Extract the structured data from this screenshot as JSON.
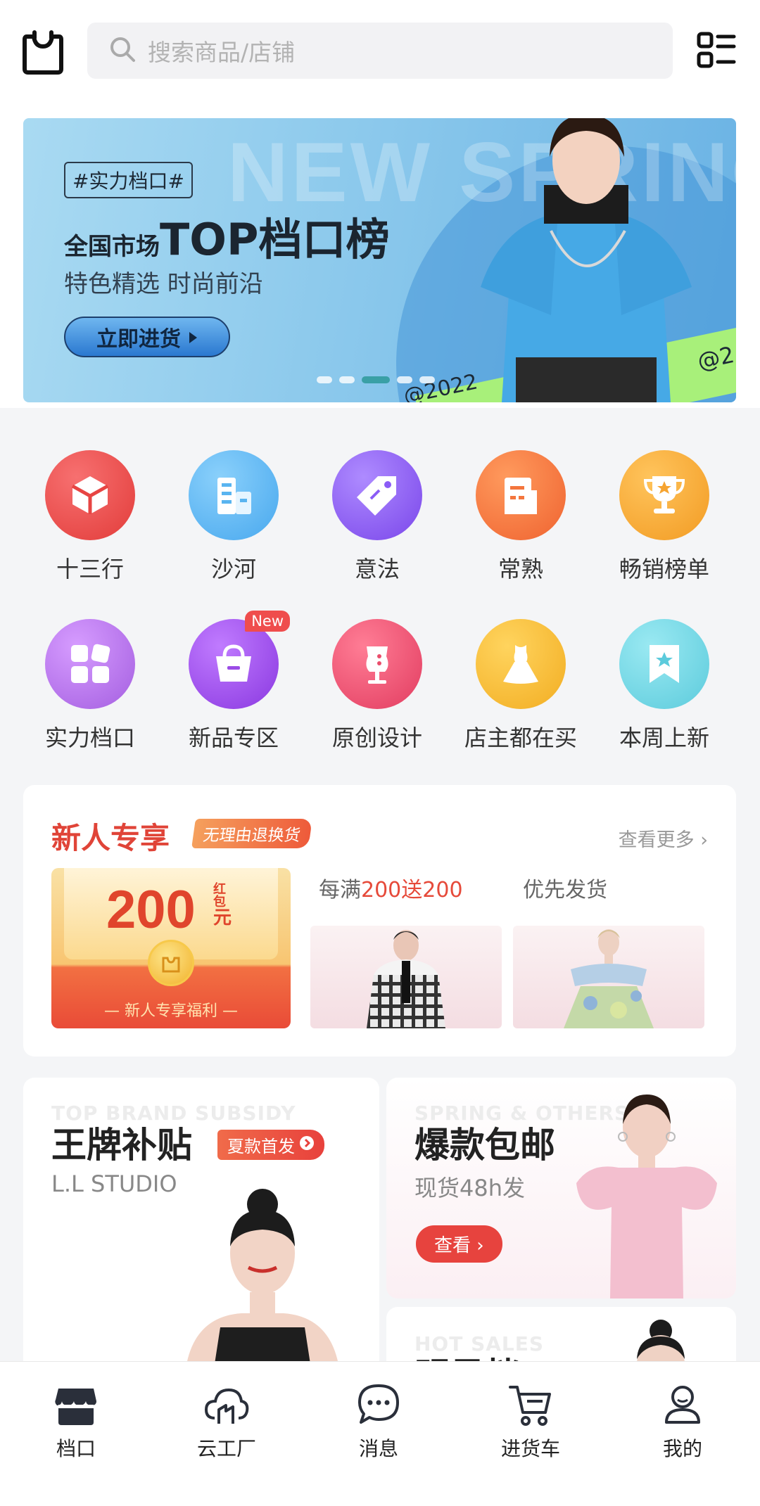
{
  "search": {
    "placeholder": "搜索商品/店铺"
  },
  "banner": {
    "tag": "#实力档口#",
    "title_prefix": "全国市场",
    "title_main": "TOP档口榜",
    "subtitle": "特色精选 时尚前沿",
    "cta": "立即进货",
    "ghost_text": "NEW SPRING",
    "watermark_1": "@2022",
    "watermark_2": "@2",
    "pager": {
      "count": 5,
      "active_index": 2
    }
  },
  "categories": [
    {
      "label": "十三行",
      "icon": "cube-icon",
      "color": "#ea4b48"
    },
    {
      "label": "沙河",
      "icon": "buildings-icon",
      "color": "#59b4f0"
    },
    {
      "label": "意法",
      "icon": "price-tag-icon",
      "color": "#8b5cf6"
    },
    {
      "label": "常熟",
      "icon": "office-icon",
      "color": "#f4763d"
    },
    {
      "label": "畅销榜单",
      "icon": "trophy-icon",
      "color": "#f6a431"
    },
    {
      "label": "实力档口",
      "icon": "grid-icon",
      "color": "#b06ee6"
    },
    {
      "label": "新品专区",
      "icon": "shopping-bag-icon",
      "color": "#9b4ce6",
      "badge": "New"
    },
    {
      "label": "原创设计",
      "icon": "mannequin-icon",
      "color": "#ea4e6c"
    },
    {
      "label": "店主都在买",
      "icon": "dress-icon",
      "color": "#f6bd3a"
    },
    {
      "label": "本周上新",
      "icon": "star-bookmark-icon",
      "color": "#6fd3e0"
    }
  ],
  "new_user": {
    "title": "新人专享",
    "tag": "无理由退换货",
    "more": "查看更多 ›",
    "red_packet": {
      "amount": "200",
      "unit_top": "红包",
      "unit_bottom": "元",
      "caption": "— 新人专享福利 —"
    },
    "promo1": {
      "prefix": "每满",
      "hl1": "200",
      "mid": "送",
      "hl2": "200"
    },
    "promo2": {
      "label": "优先发货"
    }
  },
  "cards": {
    "left": {
      "ghost": "TOP BRAND SUBSIDY",
      "title": "王牌补贴",
      "tag": "夏款首发",
      "sub": "L.L STUDIO"
    },
    "right_top": {
      "ghost": "SPRING & OTHERS",
      "title": "爆款包邮",
      "sub": "现货48h发",
      "button": "查看 ›"
    },
    "right_bottom": {
      "ghost": "HOT SALES",
      "title": "明星档口"
    }
  },
  "tabbar": [
    {
      "label": "档口",
      "icon": "store-icon",
      "active": true
    },
    {
      "label": "云工厂",
      "icon": "cloud-factory-icon"
    },
    {
      "label": "消息",
      "icon": "chat-bubble-icon"
    },
    {
      "label": "进货车",
      "icon": "cart-icon"
    },
    {
      "label": "我的",
      "icon": "user-icon"
    }
  ]
}
